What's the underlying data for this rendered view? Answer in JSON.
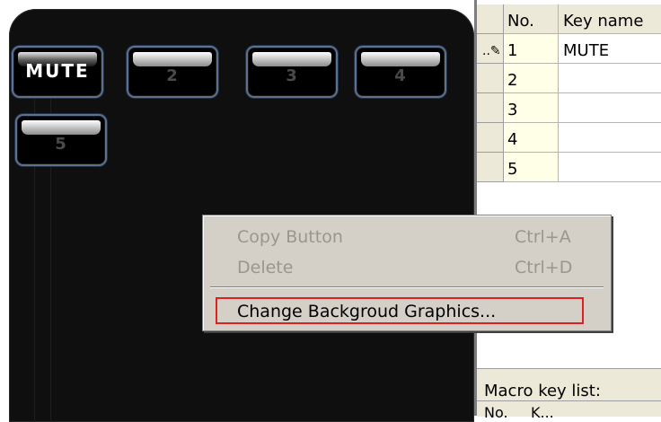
{
  "remote": {
    "keys": [
      {
        "label": "MUTE"
      },
      {
        "label": "2"
      },
      {
        "label": "3"
      },
      {
        "label": "4"
      },
      {
        "label": "5"
      }
    ]
  },
  "table": {
    "headers": {
      "num": "No.",
      "name": "Key name"
    },
    "rows": [
      {
        "num": "1",
        "name": "MUTE"
      },
      {
        "num": "2",
        "name": ""
      },
      {
        "num": "3",
        "name": ""
      },
      {
        "num": "4",
        "name": ""
      },
      {
        "num": "5",
        "name": ""
      }
    ],
    "macro_list_label": "Macro key list:",
    "macro_header_1": "No.",
    "macro_header_2": "K..."
  },
  "context_menu": {
    "items": [
      {
        "label": "Copy Button",
        "shortcut": "Ctrl+A",
        "enabled": false
      },
      {
        "label": "Delete",
        "shortcut": "Ctrl+D",
        "enabled": false
      },
      {
        "label": "Change Backgroud Graphics...",
        "shortcut": "",
        "enabled": true
      }
    ]
  },
  "colors": {
    "panel_bg": "#0f0f0f",
    "key_border": "#5a7190",
    "menu_bg": "#d4d0c8",
    "highlight_border": "#e02020",
    "row_num_bg": "#ffffe7"
  }
}
